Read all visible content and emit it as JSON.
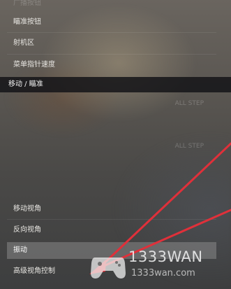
{
  "menu": {
    "top_cut_label": "广播按钮",
    "items_top": [
      {
        "label": "瞄准按钮"
      },
      {
        "label": "射机区"
      },
      {
        "label": "菜单指针速度"
      }
    ],
    "section_title": "移动 / 瞄准",
    "dim_rows": [
      {
        "label": "",
        "value": "ALL  STEP"
      },
      {
        "label": "",
        "value": ""
      },
      {
        "label": "",
        "value": "ALL  STEP"
      },
      {
        "label": "",
        "value": ""
      },
      {
        "label": "",
        "value": ""
      }
    ],
    "items_bottom": [
      {
        "label": "移动视角"
      },
      {
        "label": "反向视角"
      },
      {
        "label": "振动"
      },
      {
        "label": "高级视角控制"
      }
    ]
  },
  "watermark": {
    "main": "1333WAN",
    "sub": "1333wan.com"
  },
  "colors": {
    "arrow": "#e0303a",
    "selected_row": "#969696",
    "section_header": "#141418"
  }
}
